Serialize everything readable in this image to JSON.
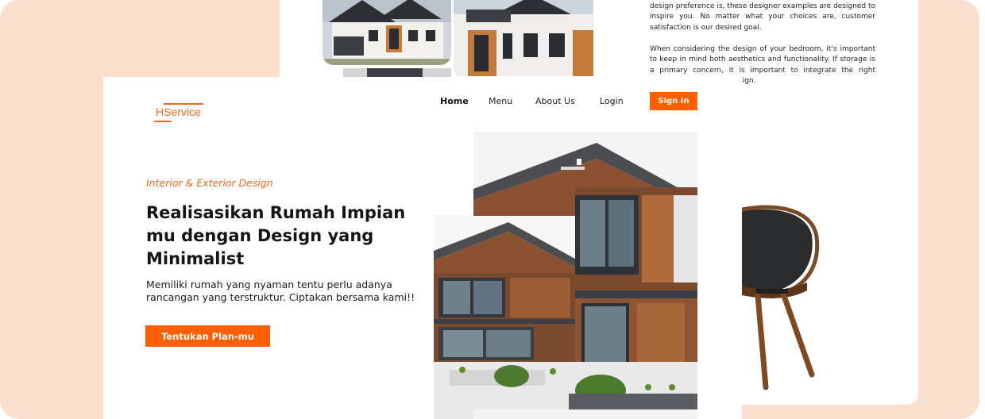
{
  "back_card": {
    "paragraph1": "design preference is, these designer examples are designed to inspire you. No matter what your choices are, customer satisfaction is our desired goal.",
    "paragraph2": "When considering the design of your bedroom, it's important to keep in mind both aesthetics and functionality. If storage is a primary concern, it is important to integrate the right cupboards",
    "paragraph2_tail": "sign."
  },
  "logo": {
    "text": "HService"
  },
  "nav": {
    "items": [
      "Home",
      "Menu",
      "About Us",
      "Login"
    ],
    "signin_label": "Sign In"
  },
  "hero": {
    "eyebrow": "Interior & Exterior Design",
    "headline": "Realisasikan Rumah Impian mu dengan Design yang Minimalist",
    "subtext": "Memiliki rumah yang nyaman tentu perlu adanya rancangan yang terstruktur. Ciptakan bersama kami!!",
    "cta_label": "Tentukan Plan-mu"
  },
  "colors": {
    "accent": "#ff5f00",
    "background": "#fbe0d0",
    "text": "#151515"
  }
}
